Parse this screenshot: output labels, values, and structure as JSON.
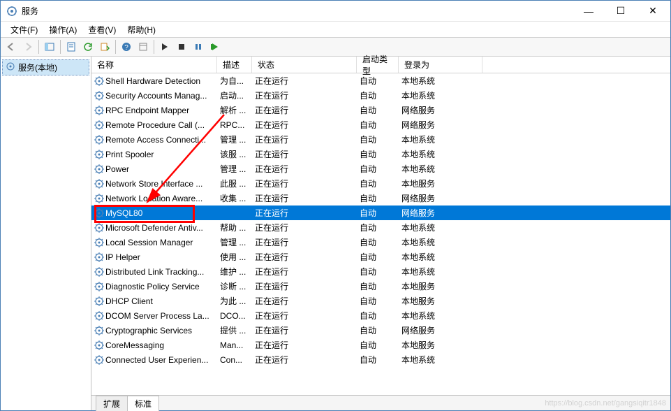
{
  "window": {
    "title": "服务",
    "min_icon": "—",
    "max_icon": "☐",
    "close_icon": "✕"
  },
  "menu": {
    "file": "文件(F)",
    "action": "操作(A)",
    "view": "查看(V)",
    "help": "帮助(H)"
  },
  "tree": {
    "root": "服务(本地)"
  },
  "columns": {
    "name": "名称",
    "desc": "描述",
    "status": "状态",
    "startup": "启动类型",
    "logon": "登录为"
  },
  "services": [
    {
      "name": "Shell Hardware Detection",
      "desc": "为自...",
      "status": "正在运行",
      "startup": "自动",
      "logon": "本地系统"
    },
    {
      "name": "Security Accounts Manag...",
      "desc": "启动...",
      "status": "正在运行",
      "startup": "自动",
      "logon": "本地系统"
    },
    {
      "name": "RPC Endpoint Mapper",
      "desc": "解析 ...",
      "status": "正在运行",
      "startup": "自动",
      "logon": "网络服务"
    },
    {
      "name": "Remote Procedure Call (...",
      "desc": "RPC...",
      "status": "正在运行",
      "startup": "自动",
      "logon": "网络服务"
    },
    {
      "name": "Remote Access Connecti...",
      "desc": "管理 ...",
      "status": "正在运行",
      "startup": "自动",
      "logon": "本地系统"
    },
    {
      "name": "Print Spooler",
      "desc": "该服 ...",
      "status": "正在运行",
      "startup": "自动",
      "logon": "本地系统"
    },
    {
      "name": "Power",
      "desc": "管理 ...",
      "status": "正在运行",
      "startup": "自动",
      "logon": "本地系统"
    },
    {
      "name": "Network Store Interface ...",
      "desc": "此服 ...",
      "status": "正在运行",
      "startup": "自动",
      "logon": "本地服务"
    },
    {
      "name": "Network Location Aware...",
      "desc": "收集 ...",
      "status": "正在运行",
      "startup": "自动",
      "logon": "网络服务"
    },
    {
      "name": "MySQL80",
      "desc": "",
      "status": "正在运行",
      "startup": "自动",
      "logon": "网络服务"
    },
    {
      "name": "Microsoft Defender Antiv...",
      "desc": "帮助 ...",
      "status": "正在运行",
      "startup": "自动",
      "logon": "本地系统"
    },
    {
      "name": "Local Session Manager",
      "desc": "管理 ...",
      "status": "正在运行",
      "startup": "自动",
      "logon": "本地系统"
    },
    {
      "name": "IP Helper",
      "desc": "使用 ...",
      "status": "正在运行",
      "startup": "自动",
      "logon": "本地系统"
    },
    {
      "name": "Distributed Link Tracking...",
      "desc": "维护 ...",
      "status": "正在运行",
      "startup": "自动",
      "logon": "本地系统"
    },
    {
      "name": "Diagnostic Policy Service",
      "desc": "诊断 ...",
      "status": "正在运行",
      "startup": "自动",
      "logon": "本地服务"
    },
    {
      "name": "DHCP Client",
      "desc": "为此 ...",
      "status": "正在运行",
      "startup": "自动",
      "logon": "本地服务"
    },
    {
      "name": "DCOM Server Process La...",
      "desc": "DCO...",
      "status": "正在运行",
      "startup": "自动",
      "logon": "本地系统"
    },
    {
      "name": "Cryptographic Services",
      "desc": "提供 ...",
      "status": "正在运行",
      "startup": "自动",
      "logon": "网络服务"
    },
    {
      "name": "CoreMessaging",
      "desc": "Man...",
      "status": "正在运行",
      "startup": "自动",
      "logon": "本地服务"
    },
    {
      "name": "Connected User Experien...",
      "desc": "Con...",
      "status": "正在运行",
      "startup": "自动",
      "logon": "本地系统"
    }
  ],
  "selected_index": 9,
  "tabs": {
    "extended": "扩展",
    "standard": "标准"
  },
  "watermark": "https://blog.csdn.net/gangsiqitr1848"
}
